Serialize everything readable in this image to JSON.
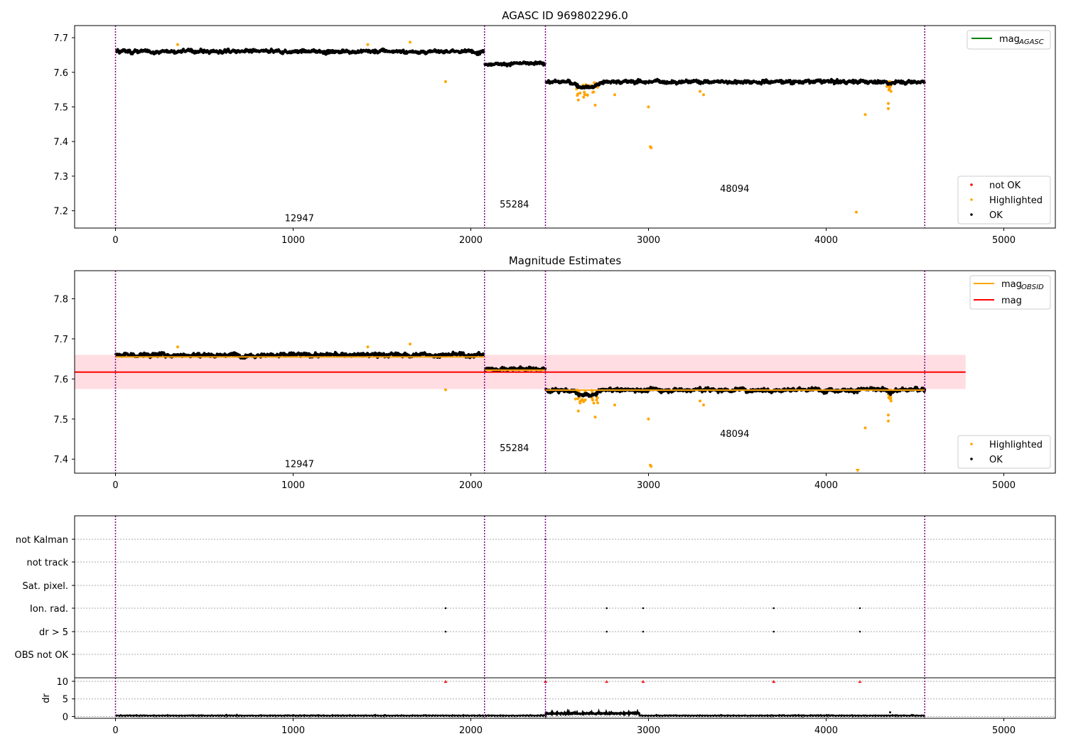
{
  "chart_data": [
    {
      "type": "scatter",
      "title": "AGASC ID 969802296.0",
      "xlim": [
        -230,
        5290
      ],
      "ylim": [
        7.15,
        7.735
      ],
      "xticks": [
        "0",
        "1000",
        "2000",
        "3000",
        "4000",
        "5000"
      ],
      "xtick_values": [
        0,
        1000,
        2000,
        3000,
        4000,
        5000
      ],
      "yticks": [
        "7.2",
        "7.3",
        "7.4",
        "7.5",
        "7.6",
        "7.7"
      ],
      "ytick_values": [
        7.2,
        7.3,
        7.4,
        7.5,
        7.6,
        7.7
      ],
      "obs_boundaries": [
        0,
        2077,
        2420,
        4555
      ],
      "obs_labels": [
        {
          "text": "12947",
          "x": 1035,
          "y": 7.17
        },
        {
          "text": "55284",
          "x": 2245,
          "y": 7.21
        },
        {
          "text": "48094",
          "x": 3485,
          "y": 7.255
        }
      ],
      "segments": [
        {
          "x0": 0,
          "x1": 2077,
          "level": 7.66,
          "noise": 0.006
        },
        {
          "x0": 2077,
          "x1": 2420,
          "level": 7.625,
          "noise": 0.005
        },
        {
          "x0": 2420,
          "x1": 4555,
          "level": 7.573,
          "noise": 0.006
        }
      ],
      "highlighted_points": [
        [
          1858,
          7.573
        ],
        [
          3010,
          7.385
        ],
        [
          3015,
          7.382
        ],
        [
          3000,
          7.5
        ],
        [
          4170,
          7.196
        ],
        [
          4220,
          7.478
        ],
        [
          2605,
          7.52
        ],
        [
          2615,
          7.54
        ],
        [
          2700,
          7.505
        ],
        [
          2810,
          7.535
        ],
        [
          3310,
          7.535
        ],
        [
          3290,
          7.545
        ],
        [
          4350,
          7.495
        ],
        [
          4350,
          7.51
        ],
        [
          4365,
          7.545
        ],
        [
          350,
          7.68
        ],
        [
          1420,
          7.68
        ],
        [
          1658,
          7.687
        ]
      ],
      "dips": [
        {
          "x": 2625,
          "depth": 0.045,
          "width": 55
        },
        {
          "x": 2690,
          "depth": 0.035,
          "width": 35
        },
        {
          "x": 4355,
          "depth": 0.025,
          "width": 20
        }
      ],
      "legend_top": {
        "entries": [
          {
            "label": "mag",
            "sub": "AGASC",
            "color": "#008000"
          }
        ],
        "placement": "upper-right"
      },
      "legend_bottom": {
        "entries": [
          {
            "label": "not OK",
            "color": "#ff0000"
          },
          {
            "label": "Highlighted",
            "color": "#ffa500"
          },
          {
            "label": "OK",
            "color": "#000000"
          }
        ],
        "placement": "lower-right"
      }
    },
    {
      "type": "scatter",
      "title": "Magnitude Estimates",
      "xlim": [
        -230,
        5290
      ],
      "ylim": [
        7.365,
        7.87
      ],
      "xticks": [
        "0",
        "1000",
        "2000",
        "3000",
        "4000",
        "5000"
      ],
      "xtick_values": [
        0,
        1000,
        2000,
        3000,
        4000,
        5000
      ],
      "yticks": [
        "7.4",
        "7.5",
        "7.6",
        "7.7",
        "7.8"
      ],
      "ytick_values": [
        7.4,
        7.5,
        7.6,
        7.7,
        7.8
      ],
      "mag": 7.617,
      "mag_band": [
        7.575,
        7.66
      ],
      "mag_band_x": [
        -230,
        4785
      ],
      "obsid_lines": [
        {
          "x0": 0,
          "x1": 2077,
          "y": 7.655
        },
        {
          "x0": 2077,
          "x1": 2420,
          "y": 7.622
        },
        {
          "x0": 2420,
          "x1": 4555,
          "y": 7.572
        }
      ],
      "obs_boundaries": [
        0,
        2077,
        2420,
        4555
      ],
      "obs_labels": [
        {
          "text": "12947",
          "x": 1035,
          "y": 7.38
        },
        {
          "text": "55284",
          "x": 2245,
          "y": 7.42
        },
        {
          "text": "48094",
          "x": 3485,
          "y": 7.455
        }
      ],
      "legend_top": {
        "entries": [
          {
            "label": "mag",
            "sub": "OBSID",
            "color": "#ffa500"
          },
          {
            "label": "mag",
            "color": "#ff0000"
          }
        ],
        "placement": "upper-right"
      },
      "legend_bottom": {
        "entries": [
          {
            "label": "Highlighted",
            "color": "#ffa500"
          },
          {
            "label": "OK",
            "color": "#000000"
          }
        ],
        "placement": "lower-right"
      }
    },
    {
      "type": "scatter",
      "title": "",
      "xlim": [
        -230,
        5290
      ],
      "ylabels": [
        "not Kalman",
        "not track",
        "Sat. pixel.",
        "Ion. rad.",
        "dr > 5",
        "OBS not OK"
      ],
      "flag_points": {
        "not Kalman": [
          2420
        ],
        "Ion. rad.": [
          1858,
          2765,
          2970,
          3705,
          4190
        ],
        "dr > 5": [
          1858,
          2765,
          2970,
          3705,
          4190
        ]
      },
      "obs_boundaries": [
        0,
        2077,
        2420,
        4555
      ]
    },
    {
      "type": "scatter",
      "title": "",
      "xlim": [
        -230,
        5290
      ],
      "ylim": [
        -0.5,
        11
      ],
      "ylabel": "dr",
      "xticks": [
        "0",
        "1000",
        "2000",
        "3000",
        "4000",
        "5000"
      ],
      "xtick_values": [
        0,
        1000,
        2000,
        3000,
        4000,
        5000
      ],
      "yticks": [
        "0",
        "5",
        "10"
      ],
      "ytick_values": [
        0,
        5,
        10
      ],
      "clipped_points": [
        1858,
        2420,
        2765,
        2970,
        3705,
        4190
      ],
      "obs_boundaries": [
        0,
        2077,
        2420,
        4555
      ]
    }
  ]
}
